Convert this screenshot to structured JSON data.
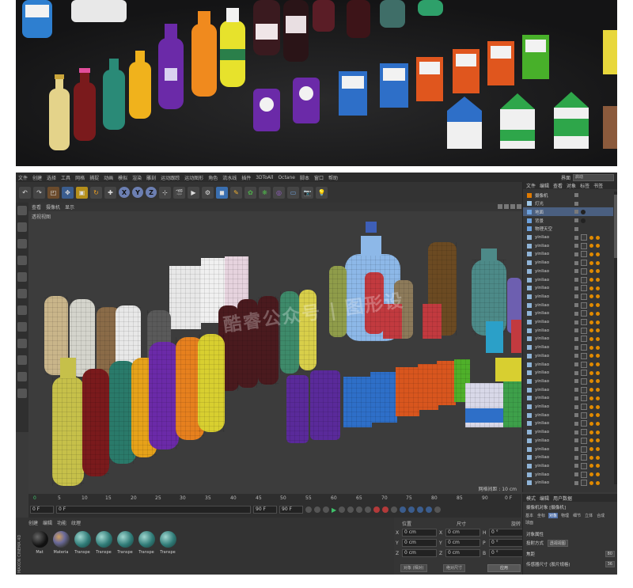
{
  "preview": {
    "description_colors": {
      "background": "#1a1a1b"
    }
  },
  "menubar": {
    "items": [
      "文件",
      "创建",
      "选择",
      "工具",
      "网格",
      "捕捉",
      "动画",
      "模拟",
      "渲染",
      "雕刻",
      "运动跟踪",
      "运动图形",
      "角色",
      "流水线",
      "插件",
      "3DToAll",
      "Octane",
      "脚本",
      "窗口",
      "帮助"
    ],
    "layout_label": "界面",
    "layout_value": "启动"
  },
  "toolbar": {
    "axis_x": "X",
    "axis_y": "Y",
    "axis_z": "Z"
  },
  "viewport": {
    "tabs": [
      "查看",
      "摄像机",
      "显示"
    ],
    "view_label": "透视视图",
    "grid_spacing": "网格间距 : 10 cm",
    "watermark": "酷睿公众号 | 图形设"
  },
  "timeline": {
    "ticks": [
      "0",
      "5",
      "10",
      "15",
      "20",
      "25",
      "30",
      "35",
      "40",
      "45",
      "50",
      "55",
      "60",
      "65",
      "70",
      "75",
      "80",
      "85",
      "90"
    ],
    "end_frame_label": "0 F",
    "start_field": "0 F",
    "current_field": "0 F",
    "end_field": "90 F",
    "end_field2": "90 F"
  },
  "materials": {
    "tabs": [
      "创建",
      "编辑",
      "功能",
      "纹理"
    ],
    "app_logo": "MAXON CINEMA 4D",
    "items": [
      {
        "name": "Mat",
        "color": "#1b1b1b"
      },
      {
        "name": "Materia",
        "color": "#6b6b6b"
      },
      {
        "name": "Transpe",
        "color": "#2f7a76"
      },
      {
        "name": "Transpe",
        "color": "#2f7a76"
      },
      {
        "name": "Transpe",
        "color": "#2f7a76"
      },
      {
        "name": "Transpe",
        "color": "#2f7a76"
      },
      {
        "name": "Transpe",
        "color": "#2f7a76"
      }
    ]
  },
  "coordinates": {
    "headers": [
      "位置",
      "尺寸",
      "旋转"
    ],
    "rows": [
      {
        "axis": "X",
        "pos": "0 cm",
        "size_axis": "X",
        "size": "0 cm",
        "rot_axis": "H",
        "rot": "0 °"
      },
      {
        "axis": "Y",
        "pos": "0 cm",
        "size_axis": "Y",
        "size": "0 cm",
        "rot_axis": "P",
        "rot": "0 °"
      },
      {
        "axis": "Z",
        "pos": "0 cm",
        "size_axis": "Z",
        "size": "0 cm",
        "rot_axis": "B",
        "rot": "0 °"
      }
    ],
    "mode_button": "对象 (相对)",
    "size_button": "绝对尺寸",
    "apply_button": "应用"
  },
  "objects": {
    "tabs": [
      "文件",
      "编辑",
      "查看",
      "对象",
      "标签",
      "书签"
    ],
    "items": [
      {
        "name": "摄像机",
        "color": "#e07a00"
      },
      {
        "name": "灯光",
        "color": "#9fc7e8"
      },
      {
        "name": "地面",
        "color": "#6ca0dc"
      },
      {
        "name": "背景",
        "color": "#6ca0dc"
      },
      {
        "name": "物理天空",
        "color": "#6ca0dc"
      },
      {
        "name": "yinliao",
        "color": "#8fb4d8"
      },
      {
        "name": "yinliao",
        "color": "#8fb4d8"
      },
      {
        "name": "yinliao",
        "color": "#8fb4d8"
      },
      {
        "name": "yinliao",
        "color": "#8fb4d8"
      },
      {
        "name": "yinliao",
        "color": "#8fb4d8"
      },
      {
        "name": "yinliao",
        "color": "#8fb4d8"
      },
      {
        "name": "yinliao",
        "color": "#8fb4d8"
      },
      {
        "name": "yinliao",
        "color": "#8fb4d8"
      },
      {
        "name": "yinliao",
        "color": "#8fb4d8"
      },
      {
        "name": "yinliao",
        "color": "#8fb4d8"
      },
      {
        "name": "yinliao",
        "color": "#8fb4d8"
      },
      {
        "name": "yinliao",
        "color": "#8fb4d8"
      },
      {
        "name": "yinliao",
        "color": "#8fb4d8"
      },
      {
        "name": "yinliao",
        "color": "#8fb4d8"
      },
      {
        "name": "yinliao",
        "color": "#8fb4d8"
      },
      {
        "name": "yinliao",
        "color": "#8fb4d8"
      },
      {
        "name": "yinliao",
        "color": "#8fb4d8"
      },
      {
        "name": "yinliao",
        "color": "#8fb4d8"
      },
      {
        "name": "yinliao",
        "color": "#8fb4d8"
      },
      {
        "name": "yinliao",
        "color": "#8fb4d8"
      },
      {
        "name": "yinliao",
        "color": "#8fb4d8"
      },
      {
        "name": "yinliao",
        "color": "#8fb4d8"
      },
      {
        "name": "yinliao",
        "color": "#8fb4d8"
      },
      {
        "name": "yinliao",
        "color": "#8fb4d8"
      },
      {
        "name": "yinliao",
        "color": "#8fb4d8"
      },
      {
        "name": "yinliao",
        "color": "#8fb4d8"
      },
      {
        "name": "yinliao",
        "color": "#8fb4d8"
      },
      {
        "name": "yinliao",
        "color": "#8fb4d8"
      },
      {
        "name": "yinliao",
        "color": "#8fb4d8"
      },
      {
        "name": "yinliao",
        "color": "#8fb4d8"
      }
    ]
  },
  "attributes": {
    "tabs": [
      "模式",
      "编辑",
      "用户数据"
    ],
    "title": "摄像机对象 [摄像机]",
    "subtabs": [
      "基本",
      "坐标",
      "对象",
      "物理",
      "细节",
      "立体",
      "合成",
      "球面"
    ],
    "active_subtab": "对象",
    "section": "对象属性",
    "projection_label": "投射方式",
    "projection_value": "透视视图",
    "focal_label": "焦距",
    "focal_value": "80",
    "sensor_label": "传感器尺寸 (胶片规格)",
    "sensor_value": "36"
  }
}
